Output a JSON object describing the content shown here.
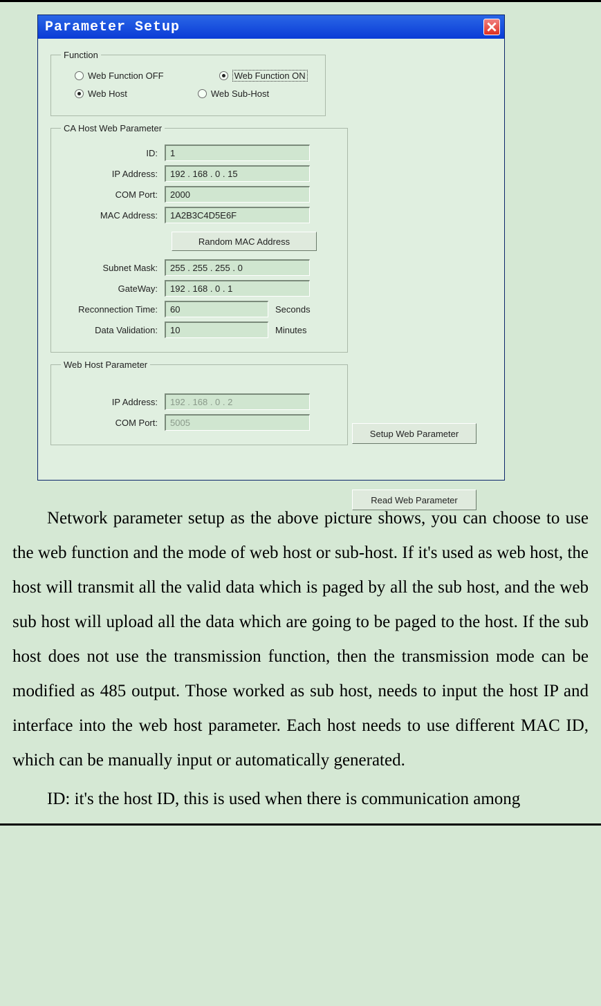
{
  "window": {
    "title": "Parameter Setup"
  },
  "function": {
    "legend": "Function",
    "off_label": "Web Function OFF",
    "on_label": "Web Function ON",
    "host_label": "Web Host",
    "subhost_label": "Web Sub-Host"
  },
  "ca": {
    "legend": "CA Host Web Parameter",
    "id_label": "ID:",
    "id_value": "1",
    "ip_label": "IP Address:",
    "ip_value": "192 . 168 .  0  . 15",
    "com_label": "COM Port:",
    "com_value": "2000",
    "mac_label": "MAC Address:",
    "mac_value": "1A2B3C4D5E6F",
    "random_mac_label": "Random MAC Address",
    "subnet_label": "Subnet Mask:",
    "subnet_value": "255 . 255 . 255 .  0",
    "gateway_label": "GateWay:",
    "gateway_value": "192 . 168 .  0  .  1",
    "reconnect_label": "Reconnection Time:",
    "reconnect_value": "60",
    "reconnect_unit": "Seconds",
    "dataval_label": "Data Validation:",
    "dataval_value": "10",
    "dataval_unit": "Minutes"
  },
  "hostparam": {
    "legend": "Web Host Parameter",
    "ip_label": "IP Address:",
    "ip_value": "192 . 168 .  0  .  2",
    "com_label": "COM Port:",
    "com_value": "5005"
  },
  "buttons": {
    "setup": "Setup Web Parameter",
    "read": "Read Web Parameter"
  },
  "paragraphs": {
    "p1": "Network parameter setup as the above picture shows, you can choose to use the web function and the mode of web host or sub-host. If it's used as web host, the host will transmit all the valid data which is paged by all the sub host, and the web sub host will upload all the data which are going to be paged to the host. If the sub host does not use the transmission function, then the transmission mode can be modified as 485 output. Those worked as sub host, needs to input the host IP and interface into the web host parameter. Each host needs to use different MAC ID, which can be manually input or automatically generated.",
    "p2": "ID: it's the host ID, this is used when there is communication among"
  }
}
